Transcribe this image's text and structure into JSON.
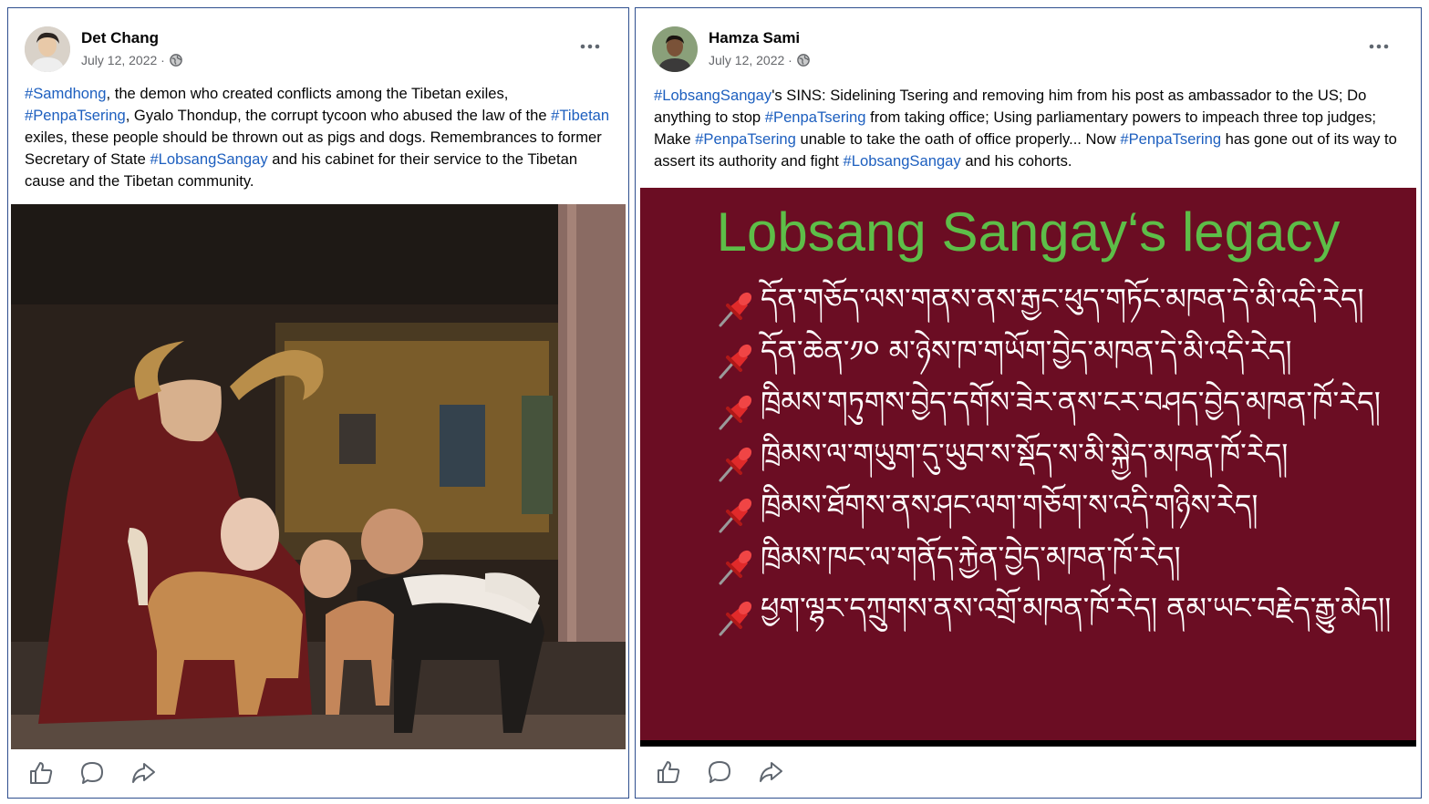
{
  "posts": [
    {
      "author": "Det Chang",
      "date": "July 12, 2022 ·",
      "text_runs": [
        {
          "t": "#Samdhong",
          "tag": true
        },
        {
          "t": ", the demon who created conflicts among the Tibetan exiles, ",
          "tag": false
        },
        {
          "t": "#PenpaTsering",
          "tag": true
        },
        {
          "t": ", Gyalo Thondup, the corrupt tycoon who abused the law of the ",
          "tag": false
        },
        {
          "t": "#Tibetan",
          "tag": true
        },
        {
          "t": " exiles, these people should be thrown out as pigs and dogs. Remembrances to former Secretary of State ",
          "tag": false
        },
        {
          "t": "#LobsangSangay",
          "tag": true
        },
        {
          "t": " and his cabinet for their service to the Tibetan cause and the Tibetan community.",
          "tag": false
        }
      ]
    },
    {
      "author": "Hamza Sami",
      "date": "July 12, 2022 ·",
      "text_runs": [
        {
          "t": "#LobsangSangay",
          "tag": true
        },
        {
          "t": "'s SINS: Sidelining Tsering and removing him from his post as ambassador to the US; Do anything to stop ",
          "tag": false
        },
        {
          "t": "#PenpaTsering",
          "tag": true
        },
        {
          "t": " from taking office;  Using parliamentary powers to impeach three top judges;  Make ",
          "tag": false
        },
        {
          "t": "#PenpaTsering",
          "tag": true
        },
        {
          "t": " unable to take the oath of office properly...  Now ",
          "tag": false
        },
        {
          "t": "#PenpaTsering",
          "tag": true
        },
        {
          "t": " has gone out of its way to assert its authority and fight ",
          "tag": false
        },
        {
          "t": "#LobsangSangay",
          "tag": true
        },
        {
          "t": " and his cohorts.",
          "tag": false
        }
      ]
    }
  ],
  "slide": {
    "title": "Lobsang Sangay‘s legacy",
    "lines": [
      "དོན་གཅོད་ལས་གནས་ནས་རྒྱང་ཕུད་གཏོང་མཁན་དེ་མི་འདི་རེད།",
      "དོན་ཆེན་༡༠ མ་ཉེས་ཁ་གཡོག་བྱེད་མཁན་དེ་མི་འདི་རེད།",
      "ཁྲིམས་གཏུགས་བྱེད་དགོས་ཟེར་ནས་ངར་བཤད་བྱེད་མཁན་ཁོ་རེད།",
      "ཁྲིམས་ལ་གཡུག་དུ་ཡུབ་ས་སྡོད་ས་མི་སྐྱེད་མཁན་ཁོ་རེད།",
      "ཁྲིམས་ཐོགས་ནས་ཤང་ལག་གཅོག་ས་འདི་གཉིས་རེད།",
      "ཁྲིམས་ཁང་ལ་གནོད་རྐྱེན་བྱེད་མཁན་ཁོ་རེད།",
      "ཕྱག་ལྷར་དཀྲུགས་ནས་འགྲོ་མཁན་ཁོ་རེད། ནམ་ཡང་བརྗེད་རྒྱུ་མེད།།"
    ],
    "bg_color": "#6b0d23",
    "title_color": "#5dbe48"
  },
  "icons": {
    "like": "thumbs-up-icon",
    "comment": "comment-icon",
    "share": "share-icon",
    "more": "more-options-icon",
    "audience": "globe-icon",
    "pin": "pushpin-icon"
  }
}
